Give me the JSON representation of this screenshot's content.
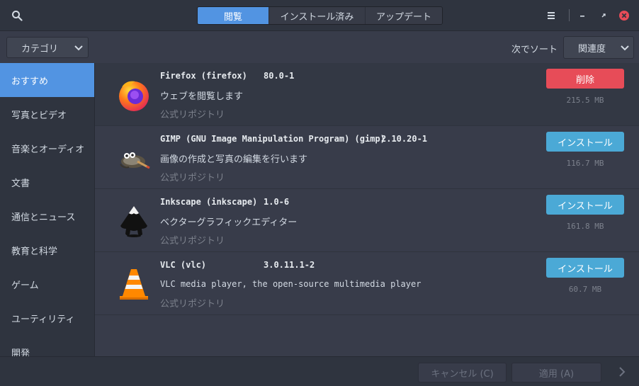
{
  "header": {
    "tabs": [
      {
        "label": "閲覧",
        "active": true
      },
      {
        "label": "インストール済み",
        "active": false
      },
      {
        "label": "アップデート",
        "active": false
      }
    ],
    "icons": [
      "search-icon",
      "hamburger-menu-icon",
      "minimize-icon",
      "restore-icon",
      "close-icon"
    ]
  },
  "toolbar": {
    "category_select": "カテゴリ",
    "sort_label": "次でソート",
    "sort_select": "関連度"
  },
  "sidebar": {
    "items": [
      {
        "label": "おすすめ",
        "active": true
      },
      {
        "label": "写真とビデオ"
      },
      {
        "label": "音楽とオーディオ"
      },
      {
        "label": "文書"
      },
      {
        "label": "通信とニュース"
      },
      {
        "label": "教育と科学"
      },
      {
        "label": "ゲーム"
      },
      {
        "label": "ユーティリティ"
      },
      {
        "label": "開発"
      }
    ]
  },
  "packages": [
    {
      "name": "Firefox (firefox)",
      "version": "80.0-1",
      "description": "ウェブを閲覧します",
      "repo": "公式リポジトリ",
      "action": "削除",
      "size": "215.5 MB",
      "icon": "firefox-icon"
    },
    {
      "name": "GIMP (GNU Image Manipulation Program) (gimp)",
      "version": "2.10.20-1",
      "description": "画像の作成と写真の編集を行います",
      "repo": "公式リポジトリ",
      "action": "インストール",
      "size": "116.7 MB",
      "icon": "gimp-icon"
    },
    {
      "name": "Inkscape (inkscape)",
      "version": "1.0-6",
      "description": "ベクターグラフィックエディター",
      "repo": "公式リポジトリ",
      "action": "インストール",
      "size": "161.8 MB",
      "icon": "inkscape-icon"
    },
    {
      "name": "VLC (vlc)",
      "version": "3.0.11.1-2",
      "description": "VLC media player, the open-source multimedia player",
      "repo": "公式リポジトリ",
      "action": "インストール",
      "size": "60.7 MB",
      "icon": "vlc-icon"
    }
  ],
  "footer": {
    "cancel_label": "キャンセル (C)",
    "apply_label": "適用 (A)"
  },
  "colors": {
    "accent": "#5294e2",
    "remove": "#e74c58",
    "install": "#4ba9d6",
    "close": "#e74c58"
  }
}
